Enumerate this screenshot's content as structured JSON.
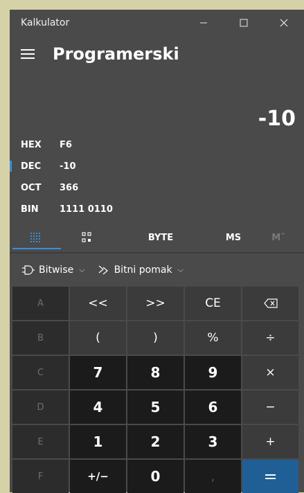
{
  "window": {
    "title": "Kalkulator",
    "minimize_icon": "minimize-icon",
    "maximize_icon": "maximize-icon",
    "close_icon": "close-icon"
  },
  "header": {
    "menu_icon": "hamburger-icon",
    "mode_title": "Programerski"
  },
  "display": {
    "value": "-10"
  },
  "bases": [
    {
      "label": "HEX",
      "value": "F6",
      "active": false
    },
    {
      "label": "DEC",
      "value": "-10",
      "active": true
    },
    {
      "label": "OCT",
      "value": "366",
      "active": false
    },
    {
      "label": "BIN",
      "value": "1111 0110",
      "active": false
    }
  ],
  "tabs": {
    "keypad_icon": "full-keypad-icon",
    "bit_icon": "bit-toggle-keypad-icon",
    "word_size": "BYTE",
    "memory_store": "MS",
    "memory_recall": "M˜"
  },
  "toolbar": {
    "bitwise_label": "Bitwise",
    "bitshift_label": "Bitni pomak"
  },
  "keys": [
    [
      "A",
      "<<",
      ">>",
      "CE",
      "⌫"
    ],
    [
      "B",
      "(",
      ")",
      "%",
      "÷"
    ],
    [
      "C",
      "7",
      "8",
      "9",
      "×"
    ],
    [
      "D",
      "4",
      "5",
      "6",
      "−"
    ],
    [
      "E",
      "1",
      "2",
      "3",
      "+"
    ],
    [
      "F",
      "+/−",
      "0",
      ",",
      "="
    ]
  ],
  "colors": {
    "accent": "#3a8fd9",
    "equals": "#1f5f96",
    "background": "#4a4a4a"
  }
}
